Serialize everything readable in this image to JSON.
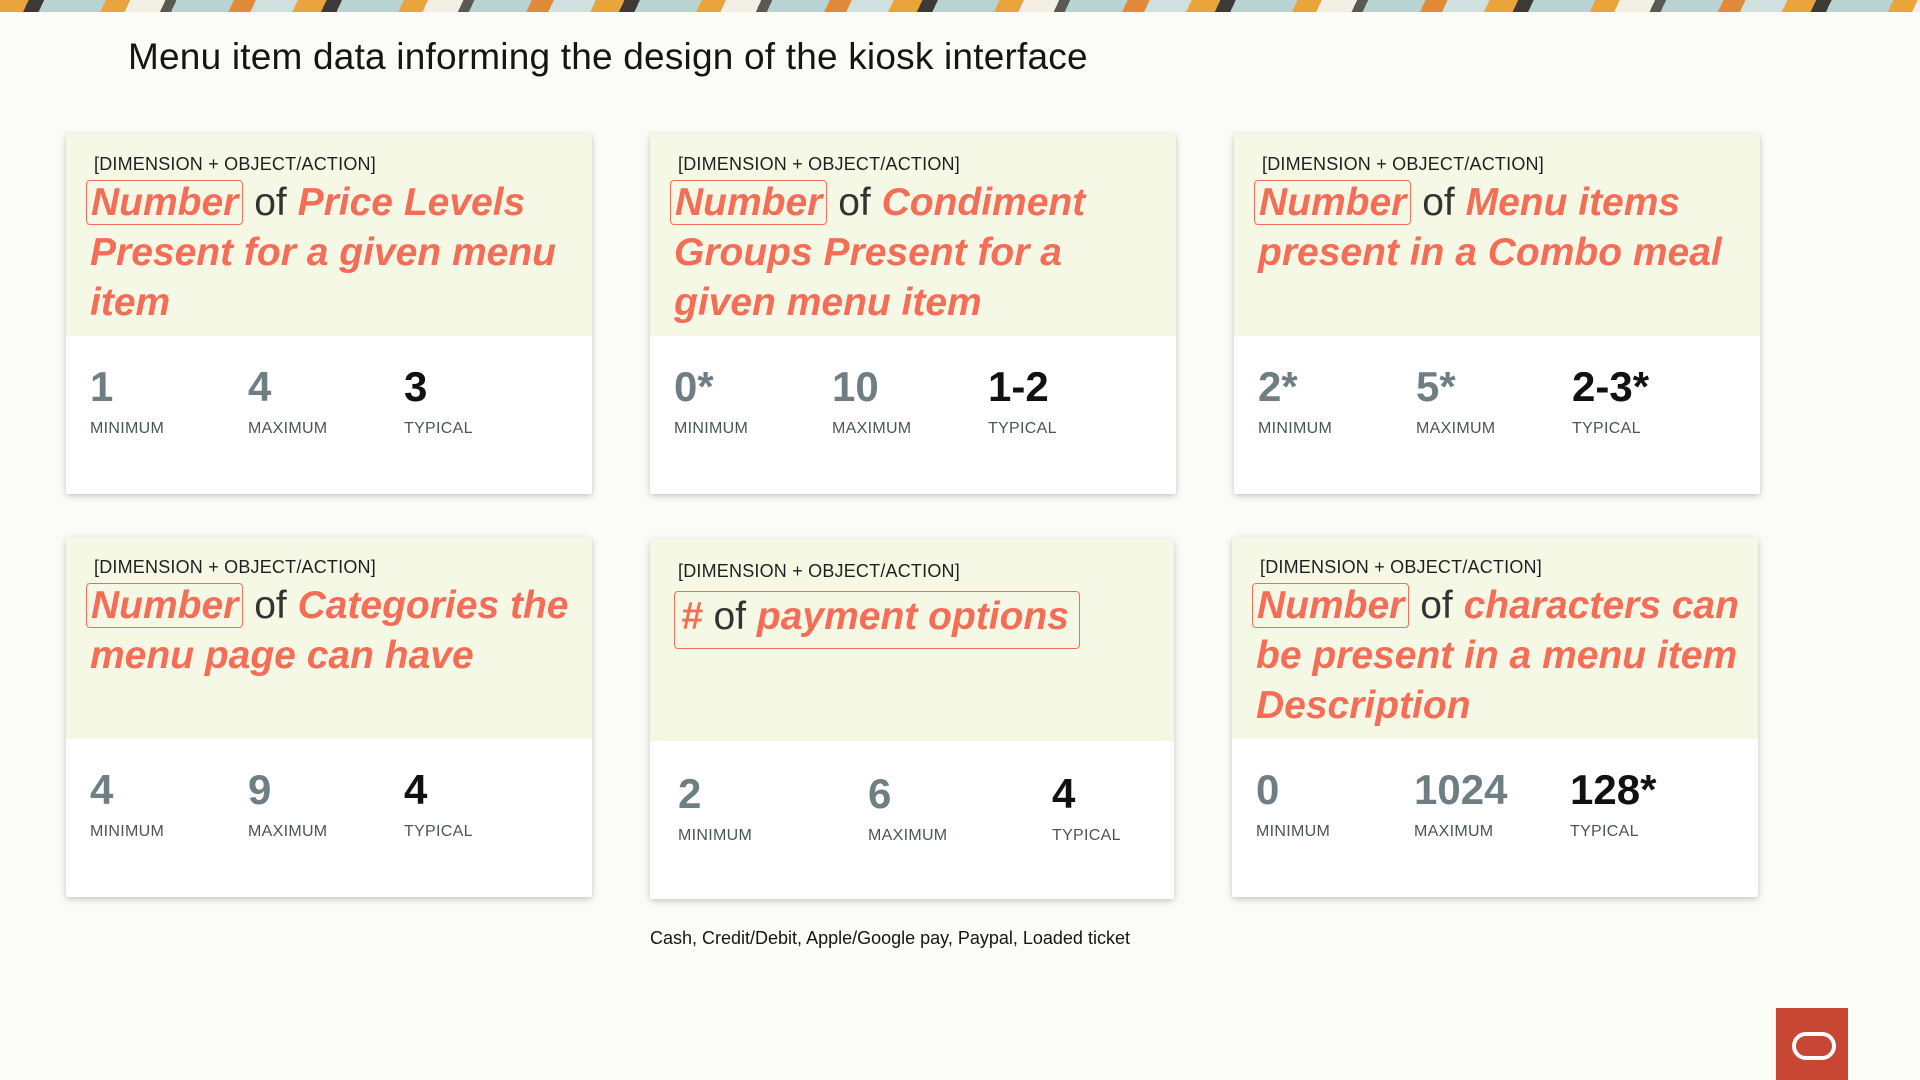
{
  "page": {
    "title": "Menu item data informing the design of the kiosk interface",
    "caption": "Cash, Credit/Debit, Apple/Google pay, Paypal, Loaded ticket"
  },
  "colors": {
    "accent": "#f46e57",
    "card_header_bg": "#f6f8e6",
    "brand": "#c74634"
  },
  "cards": [
    {
      "dimension_label": "[DIMENSION + OBJECT/ACTION]",
      "metric": "Number",
      "connector": "of",
      "object": "Price Levels Present for a given menu item",
      "stats": [
        {
          "value": "1",
          "label": "MINIMUM"
        },
        {
          "value": "4",
          "label": "MAXIMUM"
        },
        {
          "value": "3",
          "label": "TYPICAL"
        }
      ]
    },
    {
      "dimension_label": "[DIMENSION + OBJECT/ACTION]",
      "metric": "Number",
      "connector": "of",
      "object": "Condiment Groups Present for a given menu item",
      "stats": [
        {
          "value": "0*",
          "label": "MINIMUM"
        },
        {
          "value": "10",
          "label": "MAXIMUM"
        },
        {
          "value": "1-2",
          "label": "TYPICAL"
        }
      ]
    },
    {
      "dimension_label": "[DIMENSION + OBJECT/ACTION]",
      "metric": "Number",
      "connector": "of",
      "object": "Menu items present in a Combo meal",
      "stats": [
        {
          "value": "2*",
          "label": "MINIMUM"
        },
        {
          "value": "5*",
          "label": "MAXIMUM"
        },
        {
          "value": "2-3*",
          "label": "TYPICAL"
        }
      ]
    },
    {
      "dimension_label": "[DIMENSION + OBJECT/ACTION]",
      "metric": "Number",
      "connector": "of",
      "object": "Categories the menu page can have",
      "stats": [
        {
          "value": "4",
          "label": "MINIMUM"
        },
        {
          "value": "9",
          "label": "MAXIMUM"
        },
        {
          "value": "4",
          "label": "TYPICAL"
        }
      ]
    },
    {
      "dimension_label": "[DIMENSION + OBJECT/ACTION]",
      "metric": "#",
      "connector": "of",
      "object": "payment options",
      "stats": [
        {
          "value": "2",
          "label": "MINIMUM"
        },
        {
          "value": "6",
          "label": "MAXIMUM"
        },
        {
          "value": "4",
          "label": "TYPICAL"
        }
      ]
    },
    {
      "dimension_label": "[DIMENSION + OBJECT/ACTION]",
      "metric": "Number",
      "connector": "of",
      "object": "characters can be present in a menu item Description",
      "stats": [
        {
          "value": "0",
          "label": "MINIMUM"
        },
        {
          "value": "1024",
          "label": "MAXIMUM"
        },
        {
          "value": "128*",
          "label": "TYPICAL"
        }
      ]
    }
  ]
}
